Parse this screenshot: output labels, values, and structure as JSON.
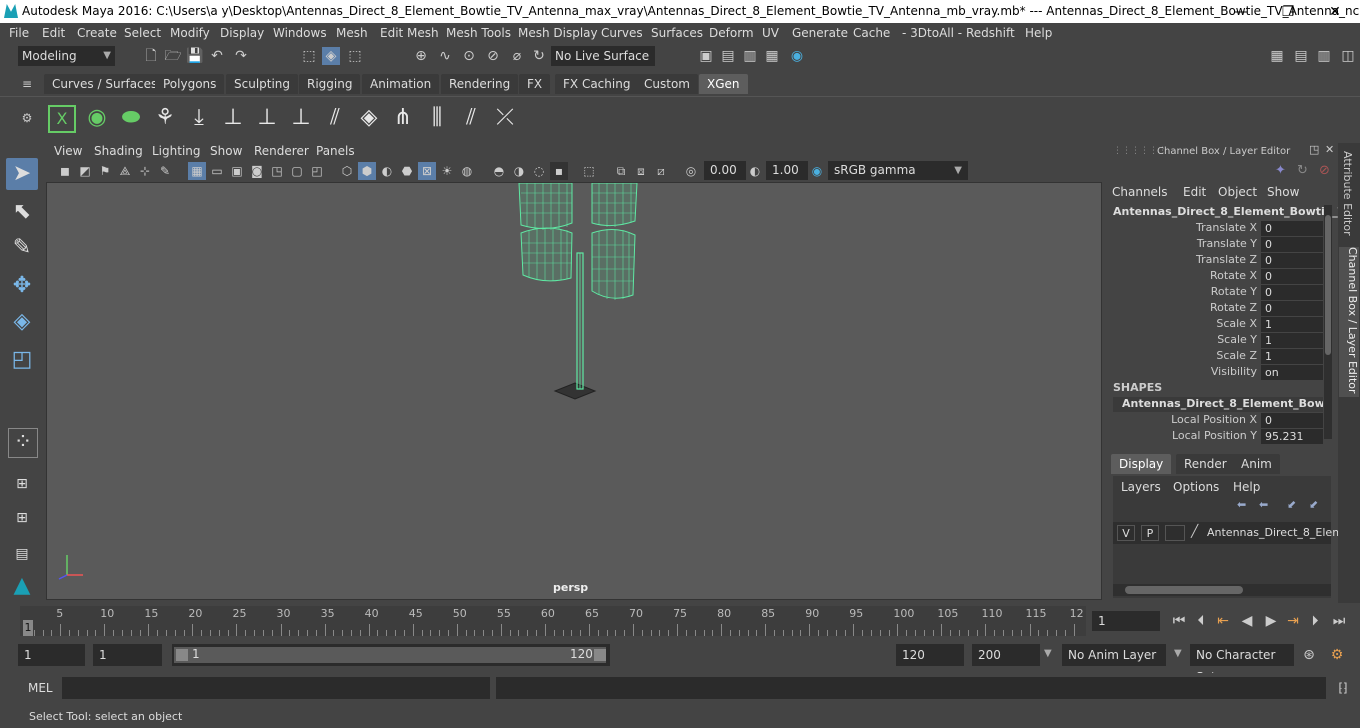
{
  "window": {
    "title": "Autodesk Maya 2016: C:\\Users\\a y\\Desktop\\Antennas_Direct_8_Element_Bowtie_TV_Antenna_max_vray\\Antennas_Direct_8_Element_Bowtie_TV_Antenna_mb_vray.mb*   ---   Antennas_Direct_8_Element_Bowtie_TV_Antenna_ncl...",
    "minimize": "—",
    "maximize": "❐",
    "close": "✕"
  },
  "menus": [
    "File",
    "Edit",
    "Create",
    "Select",
    "Modify",
    "Display",
    "Windows",
    "Mesh",
    "Edit Mesh",
    "Mesh Tools",
    "Mesh Display",
    "Curves",
    "Surfaces",
    "Deform",
    "UV",
    "Generate",
    "Cache",
    "- 3DtoAll -",
    "Redshift",
    "Help"
  ],
  "status": {
    "mode": "Modeling",
    "live_surface": "No Live Surface"
  },
  "shelf_tabs": [
    "Curves / Surfaces",
    "Polygons",
    "Sculpting",
    "Rigging",
    "Animation",
    "Rendering",
    "FX",
    "FX Caching",
    "Custom",
    "XGen"
  ],
  "active_shelf_tab": "XGen",
  "panel_menus": [
    "View",
    "Shading",
    "Lighting",
    "Show",
    "Renderer",
    "Panels"
  ],
  "viewport": {
    "exposure": "0.00",
    "gamma": "1.00",
    "color_space": "sRGB gamma",
    "camera_label": "persp",
    "mesh_color": "#5fe8a3"
  },
  "channel_box": {
    "header": "Channel Box / Layer Editor",
    "menus": [
      "Channels",
      "Edit",
      "Object",
      "Show"
    ],
    "object_name": "Antennas_Direct_8_Element_Bowtie_T...",
    "attributes": [
      {
        "label": "Translate X",
        "value": "0"
      },
      {
        "label": "Translate Y",
        "value": "0"
      },
      {
        "label": "Translate Z",
        "value": "0"
      },
      {
        "label": "Rotate X",
        "value": "0"
      },
      {
        "label": "Rotate Y",
        "value": "0"
      },
      {
        "label": "Rotate Z",
        "value": "0"
      },
      {
        "label": "Scale X",
        "value": "1"
      },
      {
        "label": "Scale Y",
        "value": "1"
      },
      {
        "label": "Scale Z",
        "value": "1"
      },
      {
        "label": "Visibility",
        "value": "on"
      }
    ],
    "shapes_header": "SHAPES",
    "shape_name": "Antennas_Direct_8_Element_Bowtie_...",
    "shape_attributes": [
      {
        "label": "Local Position X",
        "value": "0"
      },
      {
        "label": "Local Position Y",
        "value": "95.231"
      }
    ],
    "side_tab_attribute": "Attribute Editor",
    "side_tab_channel": "Channel Box / Layer Editor"
  },
  "layer_editor": {
    "tabs": [
      "Display",
      "Render",
      "Anim"
    ],
    "active_tab": "Display",
    "menus": [
      "Layers",
      "Options",
      "Help"
    ],
    "layer": {
      "v": "V",
      "p": "P",
      "name": "Antennas_Direct_8_Elem"
    }
  },
  "timeline": {
    "ticks": [
      "5",
      "10",
      "15",
      "20",
      "25",
      "30",
      "35",
      "40",
      "45",
      "50",
      "55",
      "60",
      "65",
      "70",
      "75",
      "80",
      "85",
      "90",
      "95",
      "100",
      "105",
      "110",
      "115",
      "12"
    ],
    "current_frame_marker": "1",
    "current_frame": "1"
  },
  "range": {
    "start": "1",
    "playback_start": "1",
    "slider_start": "1",
    "slider_end": "120",
    "playback_end": "120",
    "end": "200",
    "anim_layer": "No Anim Layer",
    "character_set": "No Character Set"
  },
  "command": {
    "label": "MEL"
  },
  "help_line": "Select Tool: select an object"
}
